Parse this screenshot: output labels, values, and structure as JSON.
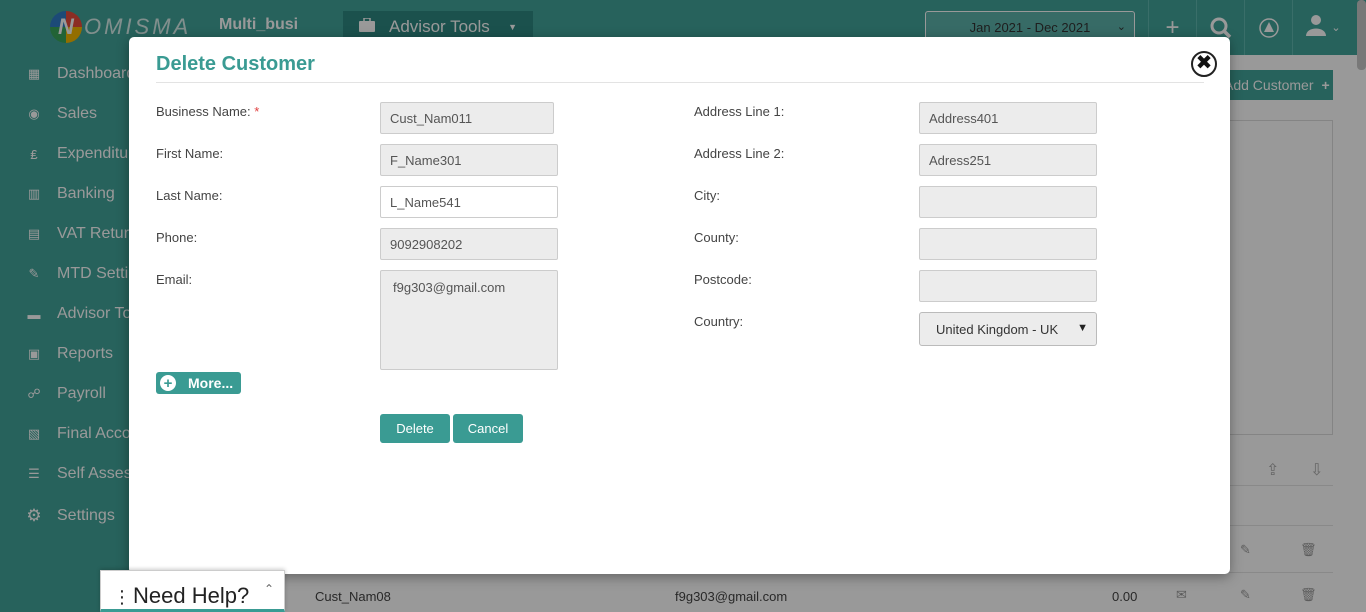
{
  "app": {
    "logo_text": "OMISMA",
    "logo_letter": "N",
    "business_name": "Multi_busi",
    "advisor_tools_label": "Advisor Tools",
    "period": "Jan 2021 - Dec 2021"
  },
  "sidebar": {
    "items": [
      {
        "label": "Dashboard",
        "icon": "dashboard-icon"
      },
      {
        "label": "Sales",
        "icon": "sales-icon"
      },
      {
        "label": "Expenditure",
        "icon": "expenditure-icon"
      },
      {
        "label": "Banking",
        "icon": "bank-icon"
      },
      {
        "label": "VAT Returns",
        "icon": "vat-icon"
      },
      {
        "label": "MTD Settings",
        "icon": "mtd-icon"
      },
      {
        "label": "Advisor Tools",
        "icon": "briefcase-icon"
      },
      {
        "label": "Reports",
        "icon": "reports-icon"
      },
      {
        "label": "Payroll",
        "icon": "payroll-icon"
      },
      {
        "label": "Final Accounts",
        "icon": "final-accounts-icon"
      },
      {
        "label": "Self Assessment",
        "icon": "self-assessment-icon"
      },
      {
        "label": "Settings",
        "icon": "gear-icon"
      }
    ]
  },
  "background": {
    "add_customer_label": "Add Customer",
    "row": {
      "name": "Cust_Nam08",
      "email": "f9g303@gmail.com",
      "amount": "0.00"
    }
  },
  "modal": {
    "title": "Delete Customer",
    "close_glyph": "✖",
    "left_fields": {
      "business_name": {
        "label": "Business Name:",
        "required_mark": "*",
        "value": "Cust_Nam011"
      },
      "first_name": {
        "label": "First Name:",
        "value": "F_Name301"
      },
      "last_name": {
        "label": "Last Name:",
        "value": "L_Name541"
      },
      "phone": {
        "label": "Phone:",
        "value": "9092908202"
      },
      "email": {
        "label": "Email:",
        "value": "f9g303@gmail.com"
      }
    },
    "right_fields": {
      "address1": {
        "label": "Address Line 1:",
        "value": "Address401"
      },
      "address2": {
        "label": "Address Line 2:",
        "value": "Adress251"
      },
      "city": {
        "label": "City:",
        "value": ""
      },
      "county": {
        "label": "County:",
        "value": ""
      },
      "postcode": {
        "label": "Postcode:",
        "value": ""
      },
      "country": {
        "label": "Country:",
        "value": "United Kingdom - UK"
      }
    },
    "more_label": "More...",
    "delete_label": "Delete",
    "cancel_label": "Cancel"
  },
  "help": {
    "label": "Need Help?"
  },
  "colors": {
    "brand": "#42a39a",
    "brand_dark": "#3a9b93",
    "required": "#e04040"
  }
}
